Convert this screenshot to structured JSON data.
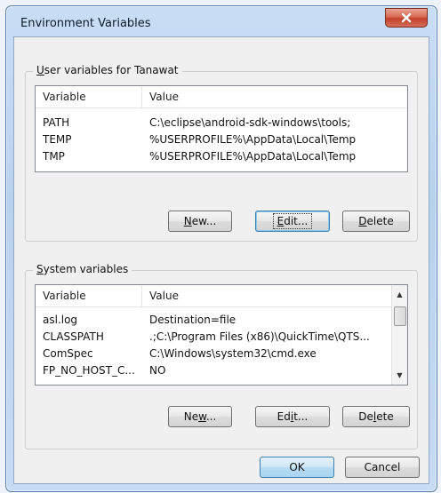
{
  "window": {
    "title": "Environment Variables"
  },
  "user_group": {
    "title_prefix": "U",
    "title_rest": "ser variables for Tanawat",
    "columns": [
      "Variable",
      "Value"
    ],
    "rows": [
      {
        "variable": "PATH",
        "value": "C:\\eclipse\\android-sdk-windows\\tools;"
      },
      {
        "variable": "TEMP",
        "value": "%USERPROFILE%\\AppData\\Local\\Temp"
      },
      {
        "variable": "TMP",
        "value": "%USERPROFILE%\\AppData\\Local\\Temp"
      }
    ],
    "buttons": {
      "new": {
        "u": "N",
        "rest": "ew..."
      },
      "edit": {
        "u": "E",
        "rest": "dit..."
      },
      "delete": {
        "u": "D",
        "rest": "elete"
      }
    }
  },
  "system_group": {
    "title_prefix": "S",
    "title_rest": "ystem variables",
    "columns": [
      "Variable",
      "Value"
    ],
    "rows": [
      {
        "variable": "asl.log",
        "value": "Destination=file"
      },
      {
        "variable": "CLASSPATH",
        "value": ".;C:\\Program Files (x86)\\QuickTime\\QTS..."
      },
      {
        "variable": "ComSpec",
        "value": "C:\\Windows\\system32\\cmd.exe"
      },
      {
        "variable": "FP_NO_HOST_C...",
        "value": "NO"
      }
    ],
    "buttons": {
      "new": {
        "pre": "Ne",
        "u": "w",
        "rest": "..."
      },
      "edit": {
        "pre": "Ed",
        "u": "i",
        "rest": "t..."
      },
      "delete": {
        "pre": "De",
        "u": "l",
        "rest": "ete"
      }
    }
  },
  "footer": {
    "ok": "OK",
    "cancel": "Cancel"
  }
}
